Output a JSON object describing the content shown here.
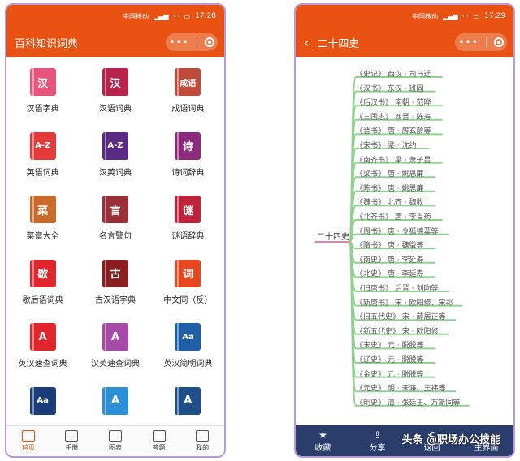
{
  "left": {
    "status": {
      "carrier": "中国移动",
      "time": "17:28"
    },
    "title": "百科知识词典",
    "items": [
      {
        "label": "汉语字典",
        "glyph": "汉",
        "color": "#e8557a"
      },
      {
        "label": "汉语词典",
        "glyph": "汉",
        "color": "#b8234c"
      },
      {
        "label": "成语词典",
        "glyph": "成语",
        "color": "#c24a3a"
      },
      {
        "label": "英语词典",
        "glyph": "A-Z",
        "color": "#e43a3a"
      },
      {
        "label": "汉英词典",
        "glyph": "A-Z",
        "color": "#5b2a86"
      },
      {
        "label": "诗词辞典",
        "glyph": "诗",
        "color": "#8e2a7d"
      },
      {
        "label": "菜谱大全",
        "glyph": "菜",
        "color": "#c96a2a"
      },
      {
        "label": "名言警句",
        "glyph": "言",
        "color": "#9a2f38"
      },
      {
        "label": "谜语辞典",
        "glyph": "谜",
        "color": "#c0243a"
      },
      {
        "label": "歇后语词典",
        "glyph": "歇",
        "color": "#e0252d"
      },
      {
        "label": "古汉语字典",
        "glyph": "古",
        "color": "#8a1e1e"
      },
      {
        "label": "中文同（反）",
        "glyph": "词",
        "color": "#e8461e"
      },
      {
        "label": "英汉速查词典",
        "glyph": "A",
        "color": "#e0252d"
      },
      {
        "label": "汉英速查词典",
        "glyph": "A",
        "color": "#a64aa8"
      },
      {
        "label": "英汉简明词典",
        "glyph": "Aa",
        "color": "#1e5fa8"
      },
      {
        "label": "",
        "glyph": "Aa",
        "color": "#1a3d7a"
      },
      {
        "label": "",
        "glyph": "A",
        "color": "#2a8fd6"
      },
      {
        "label": "",
        "glyph": "A",
        "color": "#1e4f8a"
      }
    ],
    "tabs": [
      {
        "label": "首页",
        "active": true
      },
      {
        "label": "手册"
      },
      {
        "label": "图表"
      },
      {
        "label": "答题"
      },
      {
        "label": "我的"
      }
    ]
  },
  "right": {
    "status": {
      "carrier": "中国移动",
      "time": "17:29"
    },
    "title": "二十四史",
    "root": "二十四史",
    "items": [
      "《史记》 西汉 · 司马迁",
      "《汉书》 东汉 · 班固",
      "《后汉书》 南朝 · 范晔",
      "《三国志》 西晋 · 陈寿",
      "《晋书》 唐 · 房玄龄等",
      "《宋书》 梁 · 沈约",
      "《南齐书》 梁 · 萧子显",
      "《梁书》 唐 · 姚思廉",
      "《陈书》 唐 · 姚思廉",
      "《魏书》 北齐 · 魏收",
      "《北齐书》 唐 · 李百药",
      "《周书》 唐 · 令狐德棻等",
      "《隋书》 唐 · 魏徵等",
      "《南史》 唐 · 李延寿",
      "《北史》 唐 · 李延寿",
      "《旧唐书》 后晋 · 刘昫等",
      "《新唐书》 宋 · 欧阳修、宋祁",
      "《旧五代史》 宋 · 薛居正等",
      "《新五代史》 宋 · 欧阳修",
      "《宋史》 元 · 脱脱等",
      "《辽史》 元 · 脱脱等",
      "《金史》 元 · 脱脱等",
      "《元史》 明 · 宋濂、王祎等",
      "《明史》 清 · 张廷玉、万斯同等"
    ],
    "bottom": [
      {
        "label": "收藏",
        "icon": "★"
      },
      {
        "label": "分享",
        "icon": "⇪"
      },
      {
        "label": "返回",
        "icon": "↶"
      },
      {
        "label": "主界面",
        "icon": "⌂"
      }
    ],
    "watermark": "头条 @职场办公技能"
  }
}
